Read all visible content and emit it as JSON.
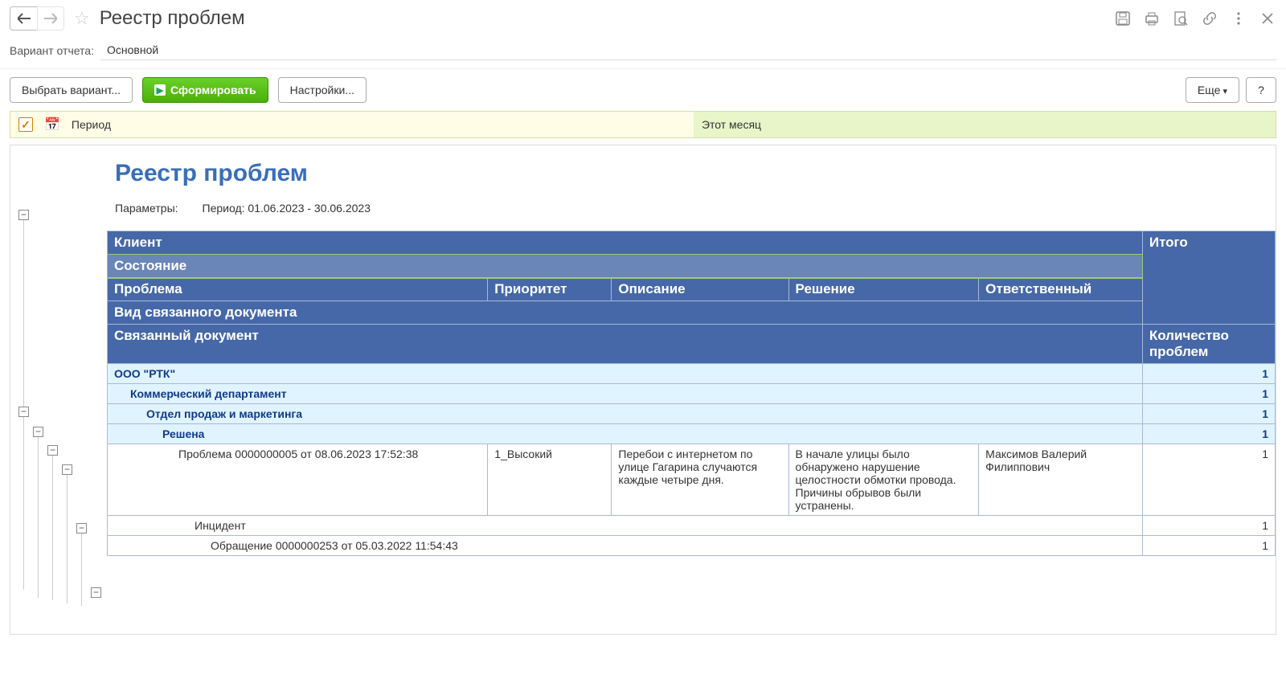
{
  "header": {
    "title": "Реестр проблем"
  },
  "variant": {
    "label": "Вариант отчета:",
    "value": "Основной"
  },
  "toolbar": {
    "select_variant": "Выбрать вариант...",
    "generate": "Сформировать",
    "settings": "Настройки...",
    "more": "Еще",
    "help": "?"
  },
  "filter": {
    "param_label": "Период",
    "param_value": "Этот месяц"
  },
  "report": {
    "title": "Реестр проблем",
    "params_label": "Параметры:",
    "params_value": "Период: 01.06.2023 - 30.06.2023",
    "headers": {
      "client": "Клиент",
      "itogo": "Итого",
      "state": "Состояние",
      "problem": "Проблема",
      "priority": "Приоритет",
      "description": "Описание",
      "solution": "Решение",
      "responsible": "Ответственный",
      "doc_type": "Вид связанного документа",
      "linked_doc": "Связанный документ",
      "count_label": "Количество проблем"
    },
    "rows": {
      "g1": {
        "label": "ООО \"РТК\"",
        "count": "1",
        "indent": 0
      },
      "g2": {
        "label": "Коммерческий департамент",
        "count": "1",
        "indent": 1
      },
      "g3": {
        "label": "Отдел продаж и маркетинга",
        "count": "1",
        "indent": 2
      },
      "g4": {
        "label": "Решена",
        "count": "1",
        "indent": 3
      },
      "d1": {
        "problem": "Проблема 0000000005 от 08.06.2023 17:52:38",
        "priority": "1_Высокий",
        "description": "Перебои с интернетом по улице Гагарина случаются каждые четыре дня.",
        "solution": "В начале улицы было обнаружено нарушение целостности обмотки провода. Причины обрывов были устранены.",
        "responsible": "Максимов Валерий Филиппович",
        "count": "1"
      },
      "g5": {
        "label": "Инцидент",
        "count": "1"
      },
      "g6": {
        "label": "Обращение 0000000253 от 05.03.2022 11:54:43",
        "count": "1"
      }
    }
  }
}
